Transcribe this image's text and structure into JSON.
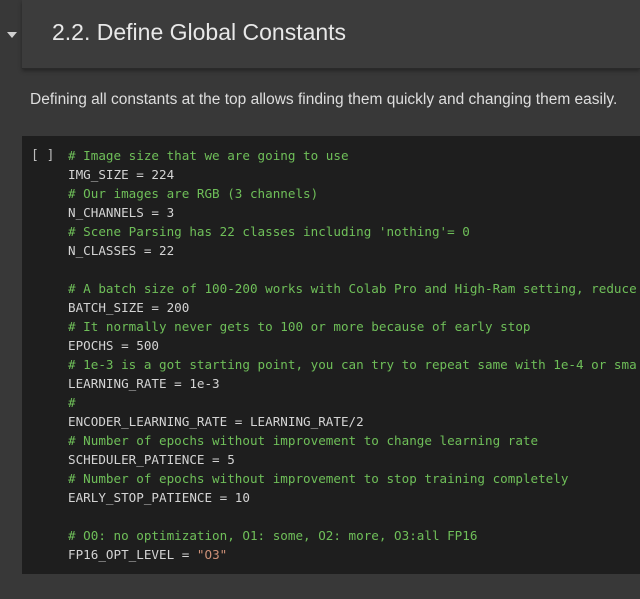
{
  "section": {
    "title": "2.2. Define Global Constants",
    "description": "Defining all constants at the top allows finding them quickly and changing them easily."
  },
  "cell": {
    "run_indicator": "[ ]",
    "lines": [
      [
        {
          "t": "comment",
          "v": "# Image size that we are going to use"
        }
      ],
      [
        {
          "t": "code",
          "v": "IMG_SIZE = 224"
        }
      ],
      [
        {
          "t": "comment",
          "v": "# Our images are RGB (3 channels)"
        }
      ],
      [
        {
          "t": "code",
          "v": "N_CHANNELS = 3"
        }
      ],
      [
        {
          "t": "comment",
          "v": "# Scene Parsing has 22 classes including 'nothing'= 0"
        }
      ],
      [
        {
          "t": "code",
          "v": "N_CLASSES = 22"
        }
      ],
      [],
      [
        {
          "t": "comment",
          "v": "# A batch size of 100-200 works with Colab Pro and High-Ram setting, reduce"
        }
      ],
      [
        {
          "t": "code",
          "v": "BATCH_SIZE = 200"
        }
      ],
      [
        {
          "t": "comment",
          "v": "# It normally never gets to 100 or more because of early stop"
        }
      ],
      [
        {
          "t": "code",
          "v": "EPOCHS = 500"
        }
      ],
      [
        {
          "t": "comment",
          "v": "# 1e-3 is a got starting point, you can try to repeat same with 1e-4 or sma"
        }
      ],
      [
        {
          "t": "code",
          "v": "LEARNING_RATE = 1e-3"
        }
      ],
      [
        {
          "t": "comment",
          "v": "#"
        }
      ],
      [
        {
          "t": "code",
          "v": "ENCODER_LEARNING_RATE = LEARNING_RATE/2"
        }
      ],
      [
        {
          "t": "comment",
          "v": "# Number of epochs without improvement to change learning rate"
        }
      ],
      [
        {
          "t": "code",
          "v": "SCHEDULER_PATIENCE = 5"
        }
      ],
      [
        {
          "t": "comment",
          "v": "# Number of epochs without improvement to stop training completely"
        }
      ],
      [
        {
          "t": "code",
          "v": "EARLY_STOP_PATIENCE = 10"
        }
      ],
      [],
      [
        {
          "t": "comment",
          "v": "# O0: no optimization, O1: some, O2: more, O3:all FP16"
        }
      ],
      [
        {
          "t": "code",
          "v": "FP16_OPT_LEVEL = "
        },
        {
          "t": "string",
          "v": "\"O3\""
        }
      ]
    ]
  },
  "icons": {
    "collapse": "caret-down-icon"
  },
  "colors": {
    "background": "#383838",
    "header_bg": "#3c3c3c",
    "code_bg": "#1e1e1e",
    "comment": "#6fbf59",
    "code_text": "#d4d4d4",
    "string": "#ce9178"
  }
}
